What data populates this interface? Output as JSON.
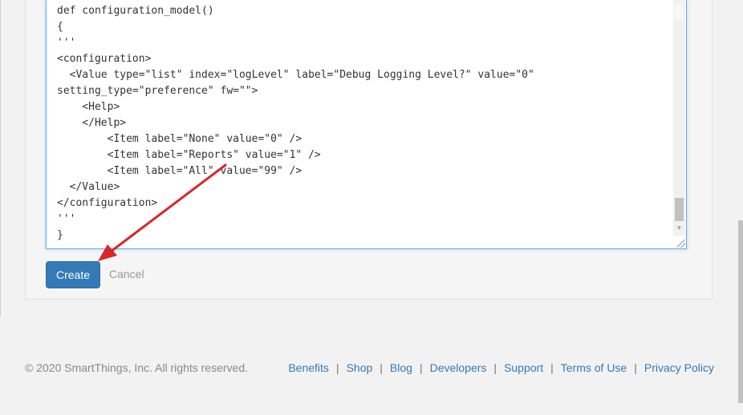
{
  "editor": {
    "lines": [
      "def configuration_model()",
      "{",
      "'''",
      "<configuration>",
      "  <Value type=\"list\" index=\"logLevel\" label=\"Debug Logging Level?\" value=\"0\"",
      "setting_type=\"preference\" fw=\"\">",
      "    <Help>",
      "    </Help>",
      "        <Item label=\"None\" value=\"0\" />",
      "        <Item label=\"Reports\" value=\"1\" />",
      "        <Item label=\"All\" value=\"99\" />",
      "  </Value>",
      "</configuration>",
      "'''",
      "}"
    ]
  },
  "form": {
    "create_label": "Create",
    "cancel_label": "Cancel"
  },
  "footer": {
    "copyright": "© 2020 SmartThings, Inc. All rights reserved.",
    "links": [
      "Benefits",
      "Shop",
      "Blog",
      "Developers",
      "Support",
      "Terms of Use",
      "Privacy Policy"
    ],
    "separator": "|"
  },
  "annotation": {
    "arrow_color": "#d9262b"
  },
  "colors": {
    "primary": "#337ab7",
    "link": "#337ab7",
    "focus_border": "#66afe9"
  }
}
